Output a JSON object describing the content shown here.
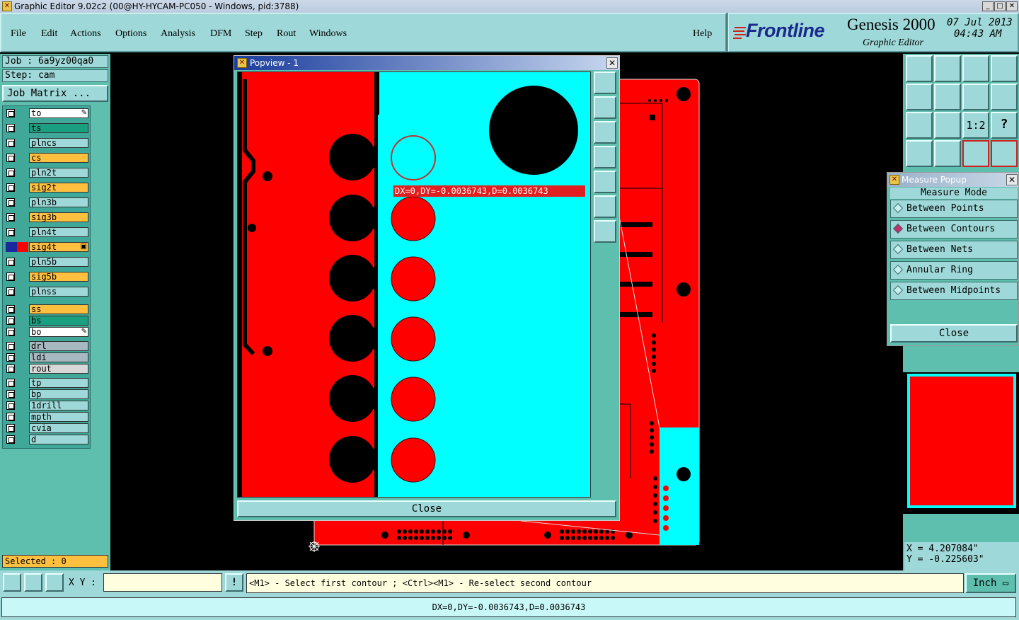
{
  "window": {
    "title": "Graphic Editor 9.02c2 (00@HY-HYCAM-PC050 - Windows, pid:3788)",
    "minimize": "_",
    "maximize": "□",
    "close": "✕"
  },
  "menu": {
    "items": [
      "File",
      "Edit",
      "Actions",
      "Options",
      "Analysis",
      "DFM",
      "Step",
      "Rout",
      "Windows"
    ],
    "help": "Help"
  },
  "brand": {
    "logo": "Frontline",
    "product": "Genesis 2000",
    "subtitle": "Graphic Editor",
    "date": "07 Jul 2013",
    "time": "04:43 AM"
  },
  "job": {
    "job_line": "Job : 6a9yz00qa0",
    "step_line": "Step: cam",
    "matrix_button": "Job Matrix ..."
  },
  "layers": [
    {
      "name": "to",
      "color": "#ffffff",
      "mark": "✎"
    },
    {
      "name": "ts",
      "color": "#1aa080",
      "mark": ""
    },
    {
      "name": "plncs",
      "color": "#9fd8d8",
      "mark": ""
    },
    {
      "name": "cs",
      "color": "#ffc040",
      "mark": ""
    },
    {
      "name": "pln2t",
      "color": "#9fd8d8",
      "mark": ""
    },
    {
      "name": "sig2t",
      "color": "#ffc040",
      "mark": ""
    },
    {
      "name": "pln3b",
      "color": "#9fd8d8",
      "mark": ""
    },
    {
      "name": "sig3b",
      "color": "#ffc040",
      "mark": ""
    },
    {
      "name": "pln4t",
      "color": "#9fd8d8",
      "mark": ""
    },
    {
      "name": "sig4t",
      "color": "#ffc040",
      "mark": "▣"
    },
    {
      "name": "pln5b",
      "color": "#9fd8d8",
      "mark": ""
    },
    {
      "name": "sig5b",
      "color": "#ffc040",
      "mark": ""
    },
    {
      "name": "plnss",
      "color": "#9fd8d8",
      "mark": ""
    },
    {
      "name": "ss",
      "color": "#ffc040",
      "mark": ""
    },
    {
      "name": "bs",
      "color": "#1aa080",
      "mark": ""
    },
    {
      "name": "bo",
      "color": "#ffffff",
      "mark": "✎"
    },
    {
      "name": "drl",
      "color": "#a8b8c0",
      "mark": ""
    },
    {
      "name": "ldi",
      "color": "#a8b8c0",
      "mark": ""
    },
    {
      "name": "rout",
      "color": "#d8d8d8",
      "mark": ""
    },
    {
      "name": "tp",
      "color": "#9fd8d8",
      "mark": ""
    },
    {
      "name": "bp",
      "color": "#9fd8d8",
      "mark": ""
    },
    {
      "name": "1drill",
      "color": "#9fd8d8",
      "mark": ""
    },
    {
      "name": "mpth",
      "color": "#9fd8d8",
      "mark": ""
    },
    {
      "name": "cvia",
      "color": "#9fd8d8",
      "mark": ""
    },
    {
      "name": "d",
      "color": "#9fd8d8",
      "mark": ""
    }
  ],
  "selected": "Selected : 0",
  "popview": {
    "title": "Popview - 1",
    "measure_label": "DX=0,DY=-0.0036743,D=0.0036743",
    "close": "Close"
  },
  "measure_popup": {
    "title": "Measure Popup",
    "mode_header": "Measure Mode",
    "options": [
      {
        "label": "Between Points",
        "selected": false
      },
      {
        "label": "Between Contours",
        "selected": true
      },
      {
        "label": "Between Nets",
        "selected": false
      },
      {
        "label": "Annular Ring",
        "selected": false
      },
      {
        "label": "Between Midpoints",
        "selected": false
      }
    ],
    "close": "Close"
  },
  "toolbar": {
    "ratio_label": "1:2",
    "help_label": "?"
  },
  "coords": {
    "x": "X = 4.207084\"",
    "y": "Y = -0.225603\""
  },
  "command": {
    "xy_label": "X Y :",
    "xy_value": "",
    "hint_icon": "!",
    "prompt": "<M1> - Select first contour ; <Ctrl><M1> - Re-select second contour",
    "units": "Inch"
  },
  "status": {
    "message": "DX=0,DY=-0.0036743,D=0.0036743"
  },
  "colors": {
    "copper": "#ff0000",
    "popview_bg": "#00ffff",
    "panel": "#5fbfae",
    "button": "#9fd8d8"
  }
}
